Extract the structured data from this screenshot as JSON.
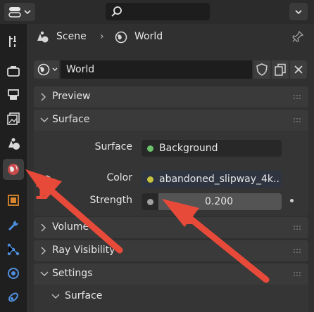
{
  "breadcrumb": {
    "scene": "Scene",
    "separator": "›",
    "world": "World"
  },
  "world_field": {
    "name": "World"
  },
  "sections": {
    "preview": "Preview",
    "surface": "Surface",
    "volume": "Volume",
    "ray_visibility": "Ray Visibility",
    "settings": "Settings",
    "settings_surface": "Surface"
  },
  "surface_props": {
    "surface_label": "Surface",
    "surface_value": "Background",
    "color_label": "Color",
    "color_value": "abandoned_slipway_4k....",
    "strength_label": "Strength",
    "strength_value": "0.200"
  },
  "annotations": {
    "arrow1": "1",
    "arrow2": "2"
  },
  "colors": {
    "accent_red": "#e84a3a",
    "socket_green": "#6cc36c",
    "socket_yellow": "#c7c23c",
    "socket_gray": "#a1a1a1"
  }
}
